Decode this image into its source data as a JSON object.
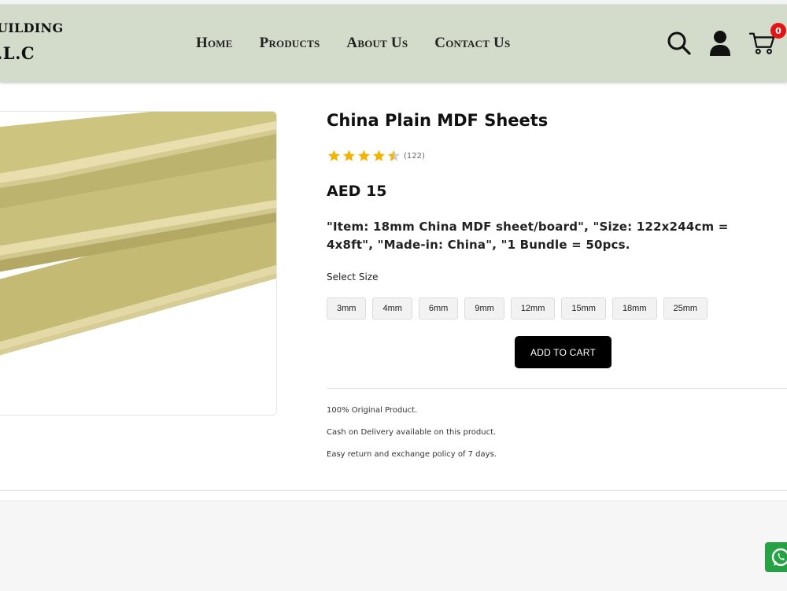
{
  "brand": {
    "line1": "UILDING",
    "line2": ".L.C"
  },
  "nav": {
    "items": [
      "Home",
      "Products",
      "About Us",
      "Contact Us"
    ]
  },
  "header_icons": [
    "search-icon",
    "user-icon",
    "cart-icon"
  ],
  "cart": {
    "count": "0"
  },
  "product": {
    "title": "China Plain MDF Sheets",
    "rating": 4.5,
    "rating_max": 5,
    "reviews": "(122)",
    "price": "AED 15",
    "description": "\"Item: 18mm China MDF sheet/board\", \"Size: 122x244cm = 4x8ft\", \"Made-in: China\", \"1 Bundle = 50pcs.",
    "select_size_label": "Select Size",
    "sizes": [
      "3mm",
      "4mm",
      "6mm",
      "9mm",
      "12mm",
      "15mm",
      "18mm",
      "25mm"
    ],
    "add_to_cart": "ADD TO CART",
    "perks": [
      "100% Original Product.",
      "Cash on Delivery available on this product.",
      "Easy return and exchange policy of 7 days."
    ]
  },
  "colors": {
    "header_bg": "#d3dbca",
    "star": "#f5b301",
    "badge": "#e21414",
    "whatsapp": "#25a244"
  }
}
